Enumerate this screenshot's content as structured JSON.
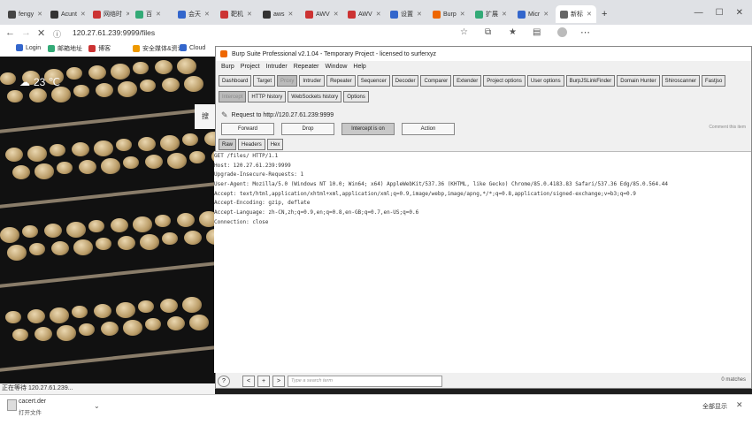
{
  "browser": {
    "tabs": [
      {
        "label": "fengy",
        "color": "#444"
      },
      {
        "label": "Acunt",
        "color": "#333"
      },
      {
        "label": "网络时",
        "color": "#c33"
      },
      {
        "label": "百",
        "color": "#3a7"
      },
      {
        "label": "会天",
        "color": "#36c"
      },
      {
        "label": "靶机",
        "color": "#c33"
      },
      {
        "label": "aws",
        "color": "#333"
      },
      {
        "label": "AWV",
        "color": "#c33"
      },
      {
        "label": "AWV",
        "color": "#c33"
      },
      {
        "label": "设置",
        "color": "#36c"
      },
      {
        "label": "Burp",
        "color": "#e60"
      },
      {
        "label": "扩展",
        "color": "#3a7"
      },
      {
        "label": "Micr",
        "color": "#36c"
      },
      {
        "label": "新标",
        "color": "#666"
      }
    ],
    "new_tab": "+",
    "window_controls": {
      "minimize": "—",
      "maximize": "☐",
      "close": "✕"
    },
    "address": "120.27.61.239:9999/files",
    "bookmarks": [
      {
        "label": "Login",
        "color": "#36c"
      },
      {
        "label": "邮箱地址",
        "color": "#3a7"
      },
      {
        "label": "博客",
        "color": "#c33"
      },
      {
        "label": "安全媒体&资讯",
        "color": "#e90"
      },
      {
        "label": "Cloud",
        "color": "#36c"
      }
    ],
    "status_url": "正在等待 120.27.61.239..."
  },
  "page": {
    "weather": "23 ℃",
    "side_label": "搜"
  },
  "downloads": {
    "file": "cacert.der",
    "action": "打开文件",
    "show_all": "全部显示"
  },
  "burp": {
    "title": "Burp Suite Professional v2.1.04 - Temporary Project - licensed to surferxyz",
    "menu": [
      "Burp",
      "Project",
      "Intruder",
      "Repeater",
      "Window",
      "Help"
    ],
    "main_tabs": [
      "Dashboard",
      "Target",
      "Proxy",
      "Intruder",
      "Repeater",
      "Sequencer",
      "Decoder",
      "Comparer",
      "Extender",
      "Project options",
      "User options",
      "BurpJSLinkFinder",
      "Domain Hunter",
      "Shiroscanner",
      "Fastjso"
    ],
    "main_active": 2,
    "sub_tabs": [
      "Intercept",
      "HTTP history",
      "WebSockets history",
      "Options"
    ],
    "sub_active": 0,
    "request_to": "Request to http://120.27.61.239:9999",
    "actions": [
      "Forward",
      "Drop",
      "Intercept is on",
      "Action"
    ],
    "comment": "Comment this item",
    "view_tabs": [
      "Raw",
      "Headers",
      "Hex"
    ],
    "request_lines": [
      "GET /files/ HTTP/1.1",
      "Host: 120.27.61.239:9999",
      "Upgrade-Insecure-Requests: 1",
      "User-Agent: Mozilla/5.0 (Windows NT 10.0; Win64; x64) AppleWebKit/537.36 (KHTML, like Gecko) Chrome/85.0.4183.83 Safari/537.36 Edg/85.0.564.44",
      "Accept: text/html,application/xhtml+xml,application/xml;q=0.9,image/webp,image/apng,*/*;q=0.8,application/signed-exchange;v=b3;q=0.9",
      "Accept-Encoding: gzip, deflate",
      "Accept-Language: zh-CN,zh;q=0.9,en;q=0.8,en-GB;q=0.7,en-US;q=0.6",
      "Connection: close"
    ],
    "search_placeholder": "Type a search term",
    "matches": "0 matches",
    "nav_buttons": [
      "<",
      "+",
      ">"
    ],
    "help": "?"
  }
}
